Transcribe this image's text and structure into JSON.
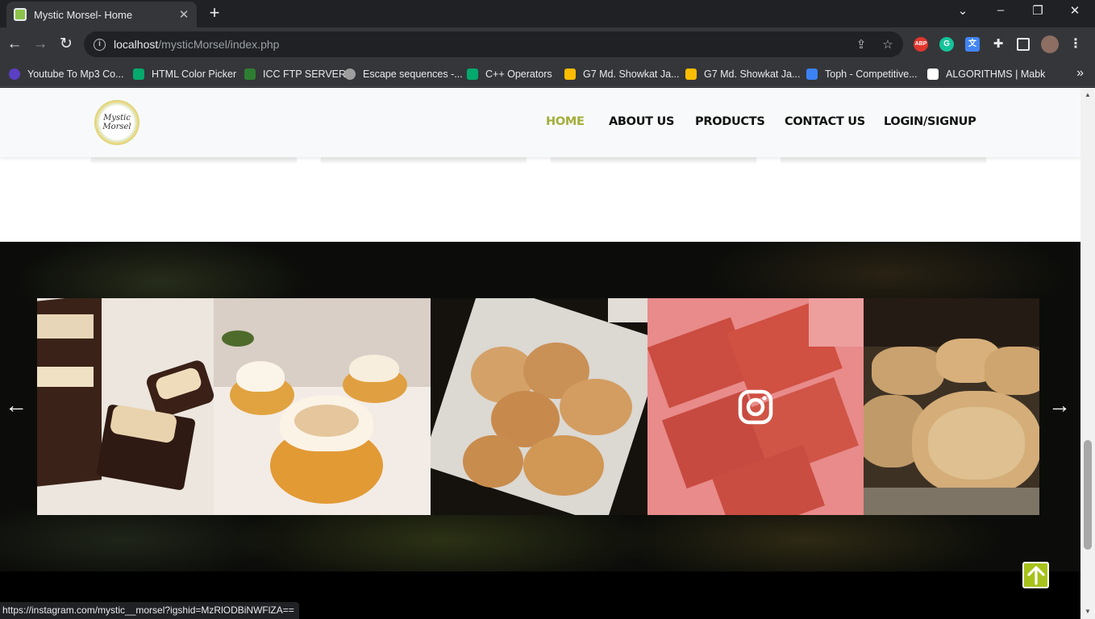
{
  "browser": {
    "tab_title": "Mystic Morsel- Home",
    "url_host": "localhost",
    "url_path": "/mysticMorsel/index.php",
    "status_url": "https://instagram.com/mystic__morsel?igshid=MzRlODBiNWFlZA=="
  },
  "bookmarks": [
    {
      "label": "Youtube To Mp3 Co...",
      "color": "#5b3fc4"
    },
    {
      "label": "HTML Color Picker",
      "color": "#04aa6d"
    },
    {
      "label": "ICC FTP SERVER",
      "color": "#2e7d32"
    },
    {
      "label": "Escape sequences -...",
      "color": "#9e9e9e"
    },
    {
      "label": "C++ Operators",
      "color": "#04aa6d"
    },
    {
      "label": "G7 Md. Showkat Ja...",
      "color": "#fbbc04"
    },
    {
      "label": "G7 Md. Showkat Ja...",
      "color": "#fbbc04"
    },
    {
      "label": "Toph - Competitive...",
      "color": "#3b82f6"
    },
    {
      "label": "ALGORITHMS | Mabk",
      "color": "#ffffff"
    }
  ],
  "extensions": {
    "abp": "ABP"
  },
  "site": {
    "logo_text": "Mystic Morsel",
    "nav": [
      "HOME",
      "ABOUT US",
      "PRODUCTS",
      "CONTACT US",
      "LOGIN/SIGNUP"
    ],
    "active_nav": "HOME",
    "accent_color": "#a3ae3a",
    "back_to_top_color": "#a6c21a"
  },
  "gallery": {
    "items": [
      "marble-brownies",
      "meringue-donuts",
      "powdered-pastries",
      "red-velvet-brownies",
      "apple-pastry"
    ],
    "hovered_item": "red-velvet-brownies"
  }
}
